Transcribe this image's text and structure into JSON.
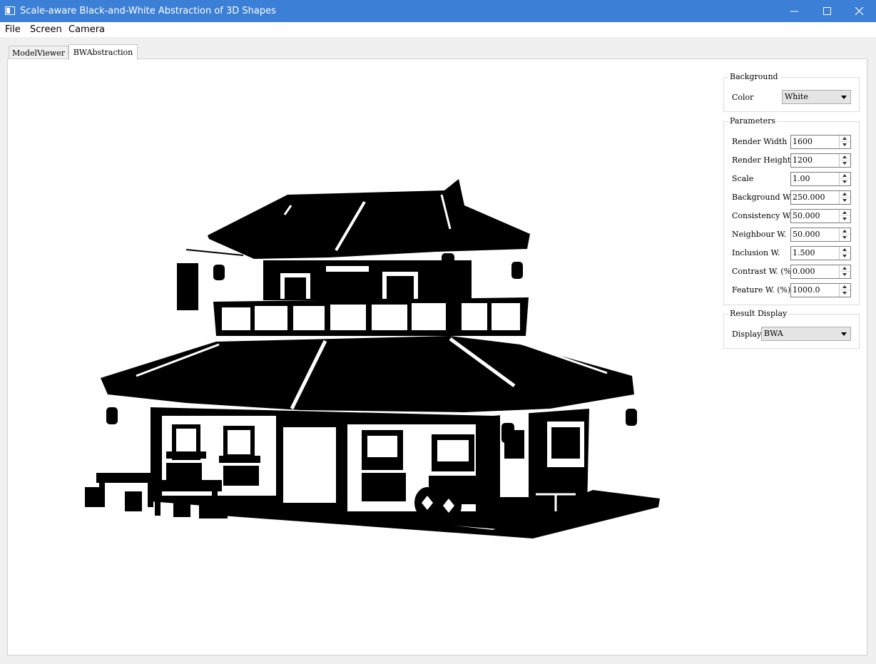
{
  "window": {
    "title": "Scale-aware Black-and-White Abstraction of 3D Shapes",
    "controls": [
      "minimize-icon",
      "maximize-icon",
      "close-icon"
    ]
  },
  "menu": {
    "items": [
      "File",
      "Screen",
      "Camera"
    ]
  },
  "tabs": [
    {
      "label": "ModelViewer",
      "active": false
    },
    {
      "label": "BWAbstraction",
      "active": true
    }
  ],
  "panel": {
    "background": {
      "title": "Background",
      "color_label": "Color",
      "color_value": "White"
    },
    "parameters": {
      "title": "Parameters",
      "fields": [
        {
          "label": "Render Width",
          "value": "1600"
        },
        {
          "label": "Render Height",
          "value": "1200"
        },
        {
          "label": "Scale",
          "value": "1.00"
        },
        {
          "label": "Background W.",
          "value": "250.000"
        },
        {
          "label": "Consistency W.",
          "value": "50.000"
        },
        {
          "label": "Neighbour W.",
          "value": "50.000"
        },
        {
          "label": "Inclusion W.",
          "value": "1.500"
        },
        {
          "label": "Contrast W. (%)",
          "value": "0.000"
        },
        {
          "label": "Feature W. (%)",
          "value": "1000.0"
        }
      ]
    },
    "result": {
      "title": "Result Display",
      "display_label": "Display",
      "display_value": "BWA"
    }
  },
  "colors": {
    "titlebar": "#3c7fd6",
    "ink": "#000000",
    "paper": "#ffffff"
  }
}
